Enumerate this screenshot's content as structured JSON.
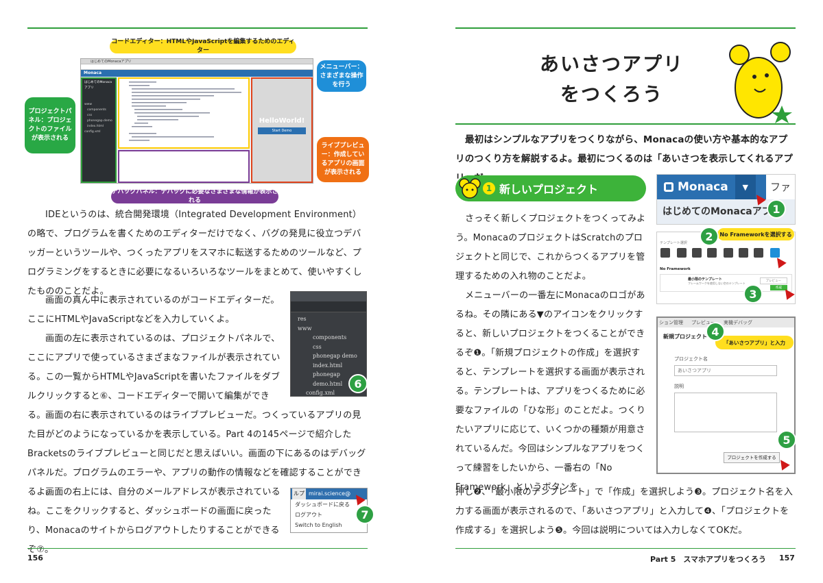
{
  "left_page": {
    "callouts": {
      "code_editor": "コードエディター：HTMLやJavaScriptを編集するためのエディター",
      "menubar": "メニューバー：さまざまな操作を行う",
      "project_panel": "プロジェクトパネル：プロジェクトのファイルが表示される",
      "live_preview": "ライブプレビュー：作成しているアプリの画面が表示される",
      "debug_panel": "デバッグパネル：デバッグに必要なさまざまな情報が表示される"
    },
    "ide": {
      "tab_title": "はじめてのMonacaアプリ",
      "brand": "Monaca",
      "project_title": "はじめてのMonacaアプリ",
      "preview_text": "HelloWorld!",
      "preview_button": "Start Demo",
      "tree": [
        "www",
        "components",
        "css",
        "phonegap.demo",
        "index.html",
        "config.xml"
      ]
    },
    "paragraphs": [
      "IDEというのは、統合開発環境（Integrated Development Environment）の略で、プログラムを書くためのエディターだけでなく、バグの発見に役立つデバッガーというツールや、つくったアプリをスマホに転送するためのツールなど、プログラミングをするときに必要になるいろいろなツールをまとめて、使いやすくしたもののことだよ。",
      "画面の真ん中に表示されているのがコードエディターだ。ここにHTMLやJavaScriptなどを入力していくよ。",
      "画面の左に表示されているのは、プロジェクトパネルで、ここにアプリで使っているさまざまなファイルが表示されている。この一覧からHTMLやJavaScriptを書いたファイルをダブルクリックすると⑥、コードエディターで開いて編集ができる。",
      "画面の右に表示されているのはライブプレビューだ。つくっているアプリの見た目がどのようになっているかを表示している。Part 4の145ページで紹介したBracketsのライブプレビューと同じだと思えばいい。画面の下にあるのはデバッグパネルだ。プログラムのエラーや、アプリの動作の情報などを確認することができるよ。",
      "画面の右上には、自分のメールアドレスが表示されているね。ここをクリックすると、ダッシュボードの画面に戻ったり、Monacaのサイトからログアウトしたりすることができるぞ⑦。"
    ],
    "file_panel": {
      "items": [
        "res",
        "www",
        "components",
        "css",
        "phonegap demo",
        "index.html",
        "phonegap demo.html",
        "config.xml"
      ],
      "badge": "6"
    },
    "account_menu": {
      "top_left": "ルプ",
      "email": "mirai.science@",
      "items": [
        "ダッシュボードに戻る",
        "ログアウト",
        "Switch to English"
      ],
      "badge": "7"
    },
    "page_number": "156"
  },
  "right_page": {
    "title_line1": "あいさつアプリ",
    "title_line2": "をつくろう",
    "intro": "最初はシンプルなアプリをつくりながら、Monacaの使い方や基本的なアプリのつくり方を解説するよ。最初につくるのは「あいさつを表示してくれるアプリ」だ。",
    "section": {
      "num": "1",
      "title": "新しいプロジェクト"
    },
    "paragraphs": [
      "さっそく新しくプロジェクトをつくってみよう。MonacaのプロジェクトはScratchのプロジェクトと同じで、これからつくるアプリを管理するための入れ物のことだよ。",
      "メニューバーの一番左にMonacaのロゴがあるね。その隣にある▼のアイコンをクリックすると、新しいプロジェクトをつくることができるぞ❶。「新規プロジェクトの作成」を選択すると、テンプレートを選択する画面が表示される。テンプレートは、アプリをつくるために必要なファイルの「ひな形」のことだよ。つくりたいアプリに応じて、いくつかの種類が用意されているんだ。今回はシンプルなアプリをつくって練習をしたいから、一番右の「No Framework」というボタンを"
    ],
    "bottom_text": "押し❷、「最小限のテンプレート」で「作成」を選択しよう❸。プロジェクト名を入力する画面が表示されるので、「あいさつアプリ」と入力して❹、「プロジェクトを作成する」を選択しよう❺。今回は説明については入力しなくてOKだ。",
    "shot1": {
      "brand": "Monaca",
      "right_cut": "ファ",
      "project": "はじめてのMonacaアプ",
      "badge": "1"
    },
    "shot2": {
      "callout": "No Frameworkを選択する",
      "label_templates": "テンプレート選択",
      "label_nf": "No Framework",
      "label_min": "最小限のテンプレート",
      "min_desc": "フレームワークを使用しない空のテンプレート",
      "preview_btn": "プレビュー",
      "create_btn": "作成",
      "badge2": "2",
      "badge3": "3"
    },
    "shot3": {
      "tabs": [
        "ション管理",
        "プレビュー",
        "実機デバッグ"
      ],
      "dialog_title": "新規プロジェクト",
      "callout": "「あいさつアプリ」と入力",
      "label_name": "プロジェクト名",
      "name_value": "あいさつアプリ",
      "label_desc": "説明",
      "create_btn": "プロジェクトを作成する",
      "badge4": "4",
      "badge5": "5"
    },
    "footer": "Part 5　スマホアプリをつくろう",
    "page_number": "157"
  },
  "colors": {
    "accent_green": "#2e9e3a",
    "section_green": "#3db33a",
    "callout_yellow": "#ffde1f"
  }
}
